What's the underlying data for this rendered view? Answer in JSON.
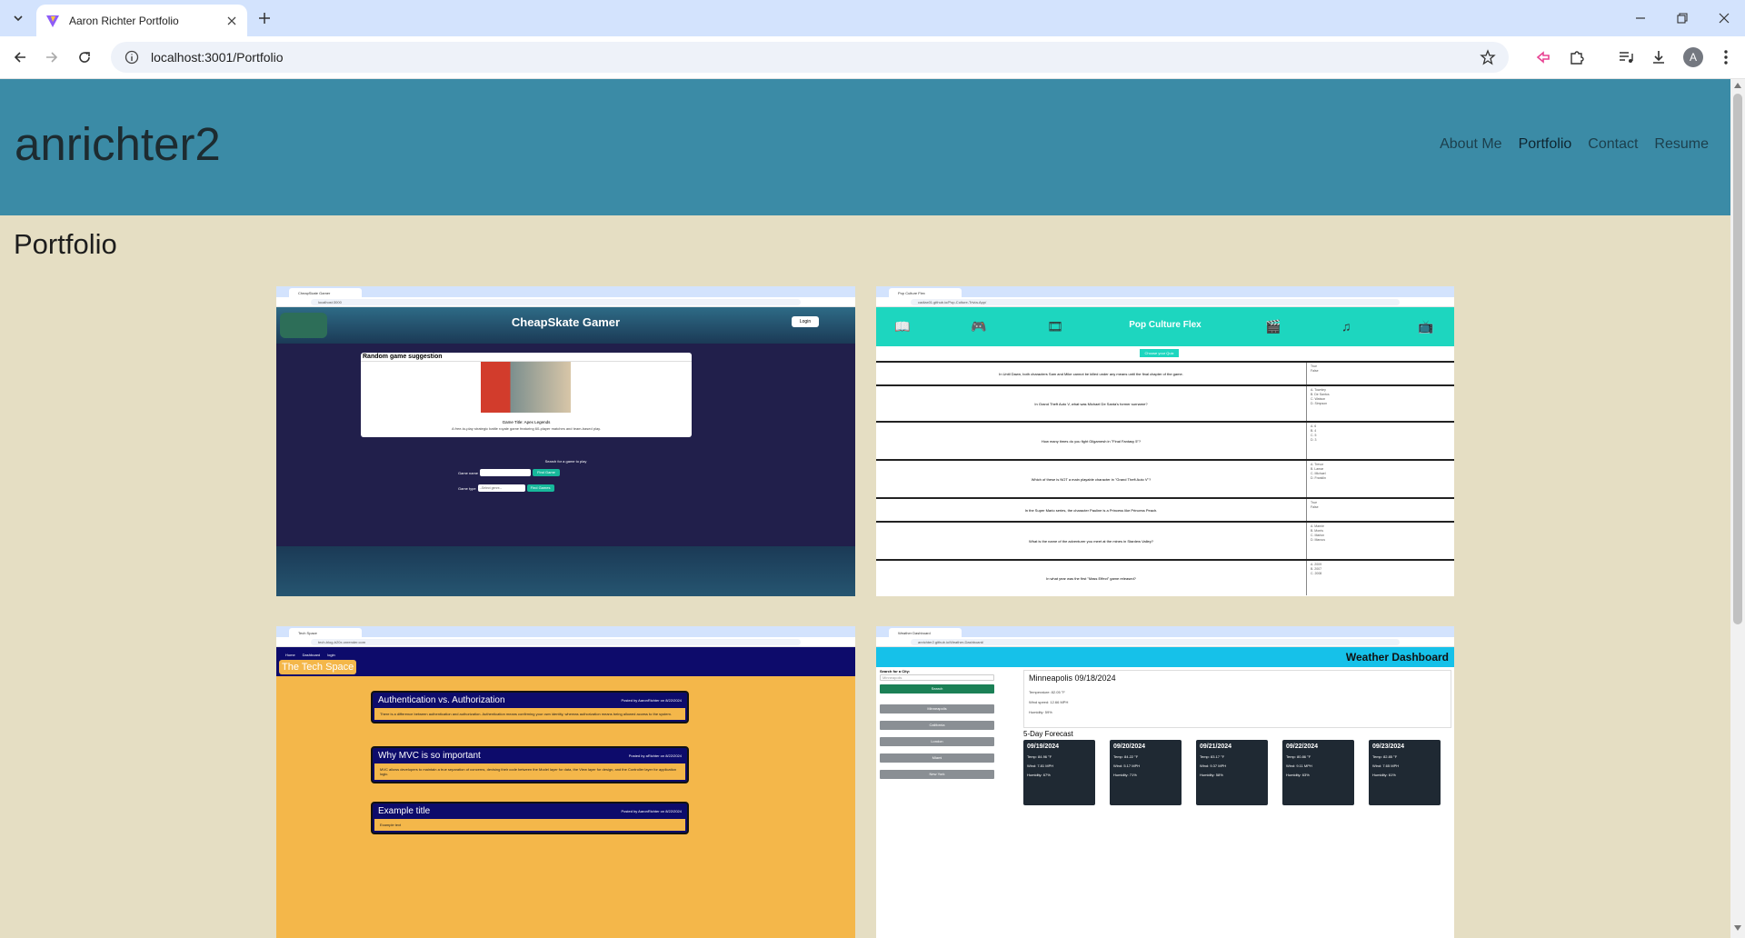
{
  "browser": {
    "tab_title": "Aaron Richter Portfolio",
    "url": "localhost:3001/Portfolio",
    "profile_initial": "A"
  },
  "site": {
    "title": "anrichter2",
    "nav": [
      "About Me",
      "Portfolio",
      "Contact",
      "Resume"
    ],
    "active_nav": "Portfolio",
    "page_heading": "Portfolio",
    "header_color": "#3b8ba6",
    "background_color": "#e5dec3"
  },
  "projects": [
    {
      "tab": "CheapSkate Gamer",
      "url": "localhost:3000",
      "title": "CheapSkate Gamer",
      "login": "Login",
      "card_title": "Random game suggestion",
      "game_title": "Game Title: Apex Legends",
      "game_desc": "A free-to-play strategic battle royale game featuring 60-player matches and team-based play.",
      "search_label": "Search for a game to play",
      "name_label": "Game name",
      "type_label": "Game type",
      "select_placeholder": "--Select genre--",
      "find_game": "Find Game",
      "find_games": "Find Games"
    },
    {
      "tab": "Pop Culture Flex",
      "url": "cadiax01.github.io/Pop-Culture-Trivia-App/",
      "title": "Pop Culture Flex",
      "choose": "Choose your Quiz",
      "questions": [
        {
          "q": "In Until Dawn, both characters Sam and Mike cannot be killed under any means until the final chapter of the game.",
          "opts": [
            "True",
            "False"
          ]
        },
        {
          "q": "In Grand Theft Auto V, what was Michael De Santa's former surname?",
          "opts": [
            "A. Townley",
            "B. De Santos",
            "C. Watson",
            "D. Simpson"
          ]
        },
        {
          "q": "How many times do you fight Gilgamesh in \"Final Fantasy 5\"?",
          "opts": [
            "A. 6",
            "B. 4",
            "C. 5",
            "D. 3"
          ]
        },
        {
          "q": "Which of these is NOT a main playable character in \"Grand Theft Auto V\"?",
          "opts": [
            "A. Trevor",
            "B. Lamar",
            "C. Michael",
            "D. Franklin"
          ]
        },
        {
          "q": "In the Super Mario series, the character Pauline is a Princess like Princess Peach.",
          "opts": [
            "True",
            "False"
          ]
        },
        {
          "q": "What is the name of the adventurer you meet at the mines in Stardew Valley?",
          "opts": [
            "A. Marnie",
            "B. Morris",
            "C. Marlon",
            "D. Marcus"
          ]
        },
        {
          "q": "In what year was the first \"Mass Effect\" game released?",
          "opts": [
            "A. 2009",
            "B. 2007",
            "C. 2008"
          ]
        }
      ]
    },
    {
      "tab": "Tech Space",
      "url": "tech-blog-b20x.onrender.com",
      "nav": [
        "Home",
        "Dashboard",
        "login"
      ],
      "brand": "The Tech Space",
      "posts": [
        {
          "title": "Authentication vs. Authorization",
          "meta": "Posted by AaronRichter on 8/22/2024",
          "body": "There is a difference between authentication and authorization. Authentication means confirming your own identity, whereas authorization means being allowed access to the system."
        },
        {
          "title": "Why MVC is so important",
          "meta": "Posted by aRichter on 8/22/2024",
          "body": "MVC allows developers to maintain a true separation of concerns, devising their code between the Model layer for data, the View layer for design, and the Controller layer for application logic."
        },
        {
          "title": "Example title",
          "meta": "Posted by AaronRichter on 8/22/2024",
          "body": "Example text"
        }
      ]
    },
    {
      "tab": "Weather Dashboard",
      "url": "anrichter2.github.io/Weather-Dashboard/",
      "title": "Weather Dashboard",
      "search_label": "Search for a City:",
      "search_value": "Minneapolis",
      "search_btn": "Search",
      "cities": [
        "Minneapolis",
        "California",
        "London",
        "Miami",
        "New York"
      ],
      "current": {
        "title": "Minneapolis 09/18/2024",
        "temp": "Temperature: 82.05 °F",
        "wind": "Wind speed: 12.66 MPH",
        "humidity": "Humidity: 59%"
      },
      "forecast_title": "5-Day Forecast",
      "forecast": [
        {
          "date": "09/19/2024",
          "temp": "Temp: 84.96 °F",
          "wind": "Wind: 7.81 MPH",
          "hum": "Humidity: 67%"
        },
        {
          "date": "09/20/2024",
          "temp": "Temp: 84.22 °F",
          "wind": "Wind: 5.17 MPH",
          "hum": "Humidity: 71%"
        },
        {
          "date": "09/21/2024",
          "temp": "Temp: 83.17 °F",
          "wind": "Wind: 9.37 MPH",
          "hum": "Humidity: 58%"
        },
        {
          "date": "09/22/2024",
          "temp": "Temp: 80.86 °F",
          "wind": "Wind: 9.11 MPH",
          "hum": "Humidity: 63%"
        },
        {
          "date": "09/23/2024",
          "temp": "Temp: 82.85 °F",
          "wind": "Wind: 7.65 MPH",
          "hum": "Humidity: 61%"
        }
      ]
    }
  ]
}
